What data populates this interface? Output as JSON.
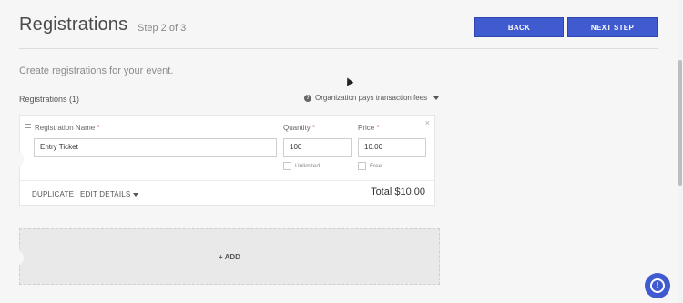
{
  "header": {
    "title": "Registrations",
    "step": "Step 2 of 3",
    "back_label": "BACK",
    "next_label": "NEXT STEP"
  },
  "main": {
    "subtitle": "Create registrations for your event.",
    "registrations_count": "Registrations (1)",
    "fees_label": "Organization pays transaction fees"
  },
  "registration_card": {
    "name_label": "Registration Name",
    "quantity_label": "Quantity",
    "price_label": "Price",
    "required_marker": "*",
    "name_value": "Entry Ticket",
    "quantity_value": "100",
    "price_value": "10.00",
    "unlimited_label": "Unlimited",
    "free_label": "Free",
    "duplicate_label": "DUPLICATE",
    "edit_details_label": "EDIT DETAILS",
    "total": "Total $10.00",
    "close_glyph": "×"
  },
  "add_zone": {
    "label": "+ ADD"
  },
  "icons": {
    "help": "question-circle-icon",
    "drag": "drag-handle-icon",
    "close": "close-icon",
    "assistant": "assistant-icon"
  },
  "colors": {
    "accent": "#3f5bcf",
    "required": "#e2566a"
  }
}
